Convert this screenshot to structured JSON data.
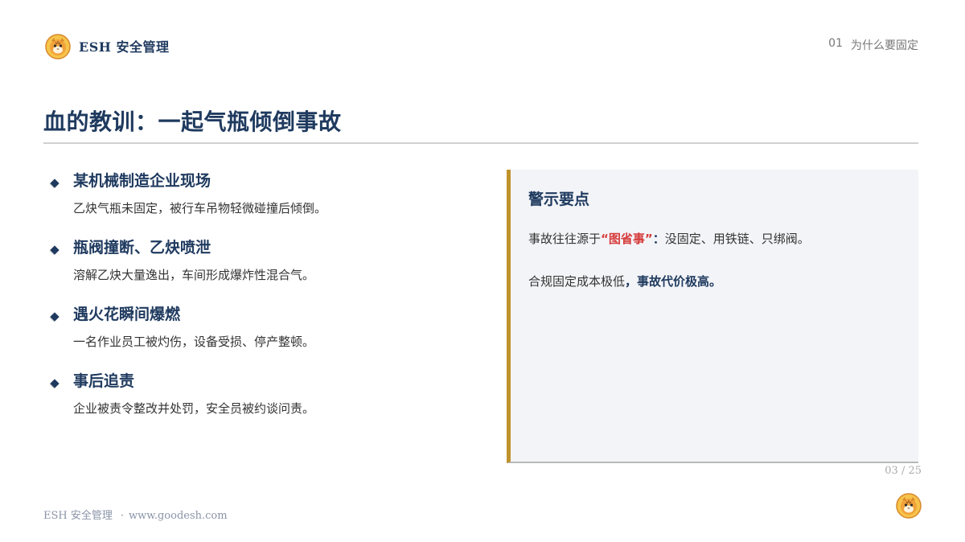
{
  "header": {
    "brand": "ESH  安全管理",
    "section_number": "01",
    "section_title": "为什么要固定",
    "logo_icon": "tiger-mascot-icon"
  },
  "title": "血的教训：一起气瓶倾倒事故",
  "points": [
    {
      "title": "某机械制造企业现场",
      "desc": "乙炔气瓶未固定，被行车吊物轻微碰撞后倾倒。"
    },
    {
      "title": "瓶阀撞断、乙炔喷泄",
      "desc": "溶解乙炔大量逸出，车间形成爆炸性混合气。"
    },
    {
      "title": "遇火花瞬间爆燃",
      "desc": "一名作业员工被灼伤，设备受损、停产整顿。"
    },
    {
      "title": "事后追责",
      "desc": "企业被责令整改并处罚，安全员被约谈问责。"
    }
  ],
  "warning": {
    "title": "警示要点",
    "line1_prefix": "事故往往源于",
    "line1_highlight": "“图省事”",
    "line1_sep": "：",
    "line1_suffix": "没固定、用铁链、只绑阀。",
    "line2_prefix": "合规固定成本极低",
    "line2_sep": "，",
    "line2_strong": "事故代价极高。"
  },
  "page_number": "03 / 25",
  "footer": {
    "brand": "ESH 安全管理",
    "separator": "·",
    "url": "www.goodesh.com"
  },
  "colors": {
    "primary": "#1f3a5f",
    "accent_bar": "#c0922b",
    "highlight_red": "#d63a3a",
    "box_bg": "#f3f4f8"
  }
}
